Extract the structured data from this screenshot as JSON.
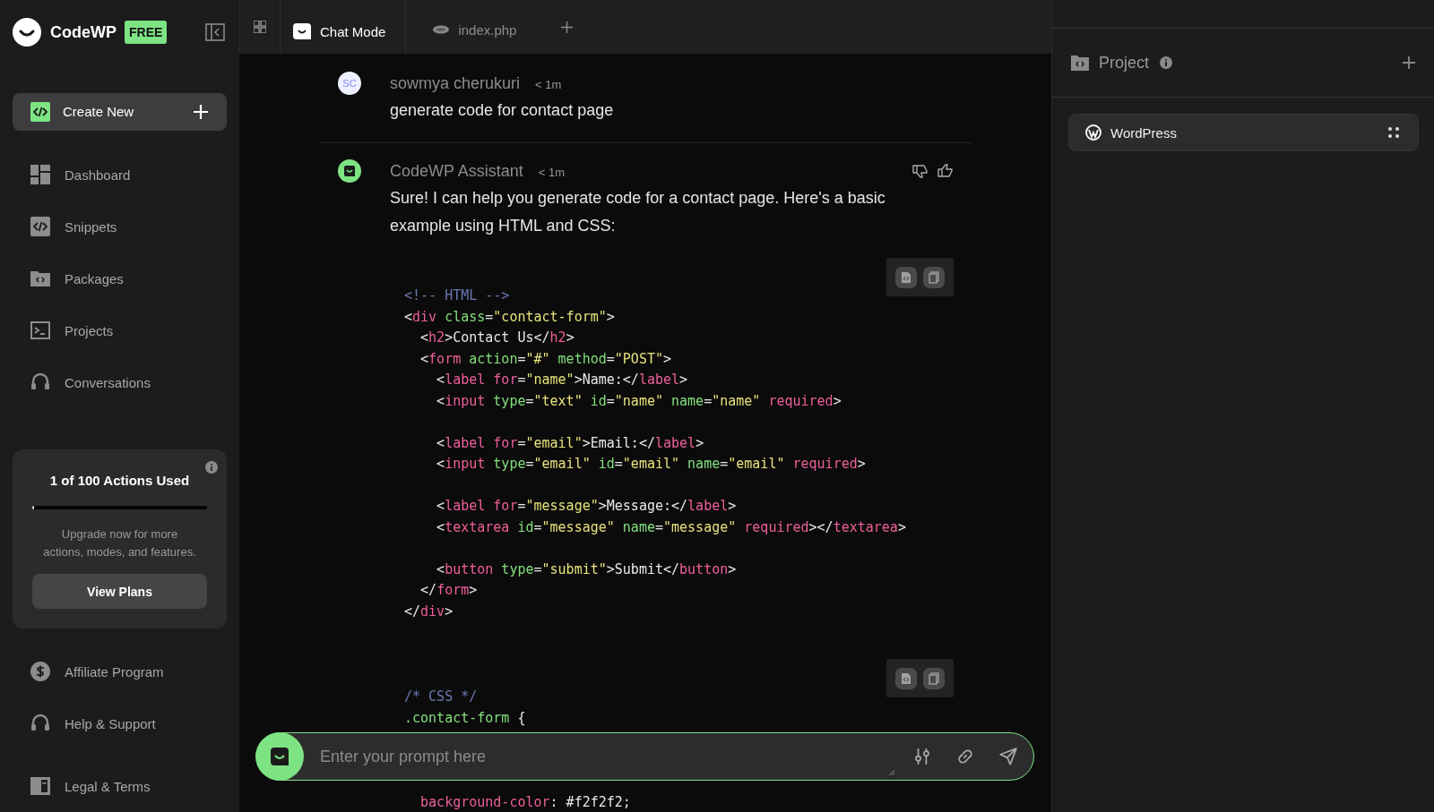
{
  "brand": {
    "name": "CodeWP",
    "badge": "FREE"
  },
  "create_button": {
    "label": "Create New"
  },
  "nav": [
    {
      "label": "Dashboard"
    },
    {
      "label": "Snippets"
    },
    {
      "label": "Packages"
    },
    {
      "label": "Projects"
    },
    {
      "label": "Conversations"
    }
  ],
  "usage": {
    "title": "1 of 100 Actions Used",
    "level": 0.01,
    "text": "Upgrade now for more actions, modes, and features.",
    "button": "View Plans"
  },
  "footer_nav": [
    {
      "label": "Affiliate Program"
    },
    {
      "label": "Help & Support"
    },
    {
      "label": "Legal & Terms"
    }
  ],
  "tabs": [
    {
      "label": "Chat Mode",
      "selected": true
    },
    {
      "label": "index.php",
      "selected": false
    }
  ],
  "messages": [
    {
      "kind": "user",
      "initials": "SC",
      "author": "sowmya cherukuri",
      "time": "< 1m",
      "text": "generate code for contact page"
    },
    {
      "kind": "assistant",
      "author": "CodeWP Assistant",
      "time": "< 1m",
      "text": "Sure! I can help you generate code for a contact page. Here's a basic example using HTML and CSS:",
      "code_blocks": [
        {
          "lines": [
            {
              "kind": "code",
              "tokens": [
                {
                  "kind": "comment",
                  "text": "<!-- HTML -->"
                }
              ]
            },
            {
              "kind": "code",
              "tokens": [
                {
                  "kind": "punct",
                  "text": "<"
                },
                {
                  "kind": "tag",
                  "text": "div"
                },
                {
                  "kind": "attr",
                  "text": " class"
                },
                {
                  "kind": "punct",
                  "text": "="
                },
                {
                  "kind": "string",
                  "text": "\"contact-form\""
                },
                {
                  "kind": "punct",
                  "text": ">"
                }
              ]
            },
            {
              "kind": "code",
              "tokens": [
                {
                  "kind": "punct",
                  "text": "  <"
                },
                {
                  "kind": "tag",
                  "text": "h2"
                },
                {
                  "kind": "punct",
                  "text": ">Contact Us</"
                },
                {
                  "kind": "tag",
                  "text": "h2"
                },
                {
                  "kind": "punct",
                  "text": ">"
                }
              ]
            },
            {
              "kind": "code",
              "tokens": [
                {
                  "kind": "punct",
                  "text": "  <"
                },
                {
                  "kind": "tag",
                  "text": "form"
                },
                {
                  "kind": "attr",
                  "text": " action"
                },
                {
                  "kind": "punct",
                  "text": "="
                },
                {
                  "kind": "string",
                  "text": "\"#\""
                },
                {
                  "kind": "attr",
                  "text": " method"
                },
                {
                  "kind": "punct",
                  "text": "="
                },
                {
                  "kind": "string",
                  "text": "\"POST\""
                },
                {
                  "kind": "punct",
                  "text": ">"
                }
              ]
            },
            {
              "kind": "code",
              "tokens": [
                {
                  "kind": "punct",
                  "text": "    <"
                },
                {
                  "kind": "tag",
                  "text": "label"
                },
                {
                  "kind": "tag",
                  "text": " for"
                },
                {
                  "kind": "punct",
                  "text": "="
                },
                {
                  "kind": "string",
                  "text": "\"name\""
                },
                {
                  "kind": "punct",
                  "text": ">Name:</"
                },
                {
                  "kind": "tag",
                  "text": "label"
                },
                {
                  "kind": "punct",
                  "text": ">"
                }
              ]
            },
            {
              "kind": "code",
              "tokens": [
                {
                  "kind": "punct",
                  "text": "    <"
                },
                {
                  "kind": "tag",
                  "text": "input"
                },
                {
                  "kind": "attr",
                  "text": " type"
                },
                {
                  "kind": "punct",
                  "text": "="
                },
                {
                  "kind": "string",
                  "text": "\"text\""
                },
                {
                  "kind": "attr",
                  "text": " id"
                },
                {
                  "kind": "punct",
                  "text": "="
                },
                {
                  "kind": "string",
                  "text": "\"name\""
                },
                {
                  "kind": "attr",
                  "text": " name"
                },
                {
                  "kind": "punct",
                  "text": "="
                },
                {
                  "kind": "string",
                  "text": "\"name\""
                },
                {
                  "kind": "tag",
                  "text": " required"
                },
                {
                  "kind": "punct",
                  "text": ">"
                }
              ]
            },
            {
              "kind": "blank"
            },
            {
              "kind": "code",
              "tokens": [
                {
                  "kind": "punct",
                  "text": "    <"
                },
                {
                  "kind": "tag",
                  "text": "label"
                },
                {
                  "kind": "tag",
                  "text": " for"
                },
                {
                  "kind": "punct",
                  "text": "="
                },
                {
                  "kind": "string",
                  "text": "\"email\""
                },
                {
                  "kind": "punct",
                  "text": ">Email:</"
                },
                {
                  "kind": "tag",
                  "text": "label"
                },
                {
                  "kind": "punct",
                  "text": ">"
                }
              ]
            },
            {
              "kind": "code",
              "tokens": [
                {
                  "kind": "punct",
                  "text": "    <"
                },
                {
                  "kind": "tag",
                  "text": "input"
                },
                {
                  "kind": "attr",
                  "text": " type"
                },
                {
                  "kind": "punct",
                  "text": "="
                },
                {
                  "kind": "string",
                  "text": "\"email\""
                },
                {
                  "kind": "attr",
                  "text": " id"
                },
                {
                  "kind": "punct",
                  "text": "="
                },
                {
                  "kind": "string",
                  "text": "\"email\""
                },
                {
                  "kind": "attr",
                  "text": " name"
                },
                {
                  "kind": "punct",
                  "text": "="
                },
                {
                  "kind": "string",
                  "text": "\"email\""
                },
                {
                  "kind": "tag",
                  "text": " required"
                },
                {
                  "kind": "punct",
                  "text": ">"
                }
              ]
            },
            {
              "kind": "blank"
            },
            {
              "kind": "code",
              "tokens": [
                {
                  "kind": "punct",
                  "text": "    <"
                },
                {
                  "kind": "tag",
                  "text": "label"
                },
                {
                  "kind": "tag",
                  "text": " for"
                },
                {
                  "kind": "punct",
                  "text": "="
                },
                {
                  "kind": "string",
                  "text": "\"message\""
                },
                {
                  "kind": "punct",
                  "text": ">Message:</"
                },
                {
                  "kind": "tag",
                  "text": "label"
                },
                {
                  "kind": "punct",
                  "text": ">"
                }
              ]
            },
            {
              "kind": "code",
              "tokens": [
                {
                  "kind": "punct",
                  "text": "    <"
                },
                {
                  "kind": "tag",
                  "text": "textarea"
                },
                {
                  "kind": "attr",
                  "text": " id"
                },
                {
                  "kind": "punct",
                  "text": "="
                },
                {
                  "kind": "string",
                  "text": "\"message\""
                },
                {
                  "kind": "attr",
                  "text": " name"
                },
                {
                  "kind": "punct",
                  "text": "="
                },
                {
                  "kind": "string",
                  "text": "\"message\""
                },
                {
                  "kind": "tag",
                  "text": " required"
                },
                {
                  "kind": "punct",
                  "text": "></"
                },
                {
                  "kind": "tag",
                  "text": "textarea"
                },
                {
                  "kind": "punct",
                  "text": ">"
                }
              ]
            },
            {
              "kind": "blank"
            },
            {
              "kind": "code",
              "tokens": [
                {
                  "kind": "punct",
                  "text": "    <"
                },
                {
                  "kind": "tag",
                  "text": "button"
                },
                {
                  "kind": "attr",
                  "text": " type"
                },
                {
                  "kind": "punct",
                  "text": "="
                },
                {
                  "kind": "string",
                  "text": "\"submit\""
                },
                {
                  "kind": "punct",
                  "text": ">Submit</"
                },
                {
                  "kind": "tag",
                  "text": "button"
                },
                {
                  "kind": "punct",
                  "text": ">"
                }
              ]
            },
            {
              "kind": "code",
              "tokens": [
                {
                  "kind": "punct",
                  "text": "  </"
                },
                {
                  "kind": "tag",
                  "text": "form"
                },
                {
                  "kind": "punct",
                  "text": ">"
                }
              ]
            },
            {
              "kind": "code",
              "tokens": [
                {
                  "kind": "punct",
                  "text": "</"
                },
                {
                  "kind": "tag",
                  "text": "div"
                },
                {
                  "kind": "punct",
                  "text": ">"
                }
              ]
            }
          ]
        },
        {
          "lines": [
            {
              "kind": "code",
              "tokens": [
                {
                  "kind": "comment",
                  "text": "/* CSS */"
                }
              ]
            },
            {
              "kind": "code",
              "tokens": [
                {
                  "kind": "selector",
                  "text": ".contact-form"
                },
                {
                  "kind": "punct",
                  "text": " {"
                }
              ]
            },
            {
              "kind": "blank"
            },
            {
              "kind": "blank"
            },
            {
              "kind": "blank"
            },
            {
              "kind": "code",
              "tokens": [
                {
                  "kind": "property",
                  "text": "  background-color"
                },
                {
                  "kind": "punct",
                  "text": ": #f2f2f2;"
                }
              ]
            }
          ]
        }
      ]
    }
  ],
  "prompt": {
    "placeholder": "Enter your prompt here"
  },
  "project_panel": {
    "title": "Project",
    "items": [
      {
        "label": "WordPress"
      }
    ]
  }
}
